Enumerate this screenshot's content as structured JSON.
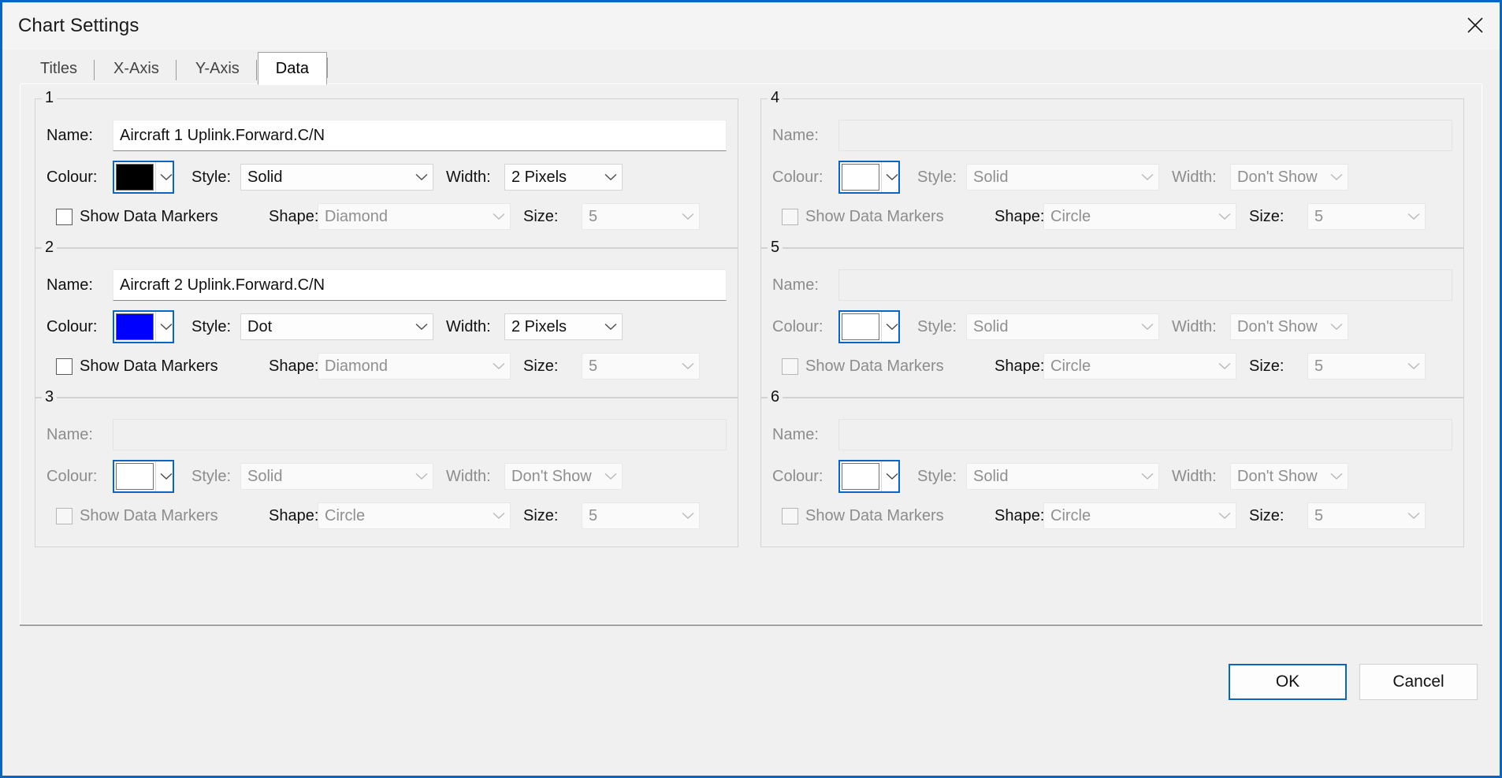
{
  "window": {
    "title": "Chart Settings",
    "close_icon": "close-icon",
    "accent_color": "#0a65c2",
    "background_color": "#f0f0f0"
  },
  "tabs": [
    {
      "label": "Titles",
      "active": false
    },
    {
      "label": "X-Axis",
      "active": false
    },
    {
      "label": "Y-Axis",
      "active": false
    },
    {
      "label": "Data",
      "active": true
    }
  ],
  "labels": {
    "name": "Name:",
    "colour": "Colour:",
    "style": "Style:",
    "width": "Width:",
    "show_data_markers": "Show Data Markers",
    "shape": "Shape:",
    "size": "Size:"
  },
  "series": [
    {
      "number": "1",
      "name": "Aircraft 1 Uplink.Forward.C/N",
      "name_placeholder": "",
      "colour": "#000000",
      "style": "Solid",
      "width": "2 Pixels",
      "show_data_markers": false,
      "shape": "Diamond",
      "size": "5",
      "enabled": true,
      "markers_enabled": false
    },
    {
      "number": "2",
      "name": "Aircraft 2 Uplink.Forward.C/N",
      "name_placeholder": "",
      "colour": "#0000ff",
      "style": "Dot",
      "width": "2 Pixels",
      "show_data_markers": false,
      "shape": "Diamond",
      "size": "5",
      "enabled": true,
      "markers_enabled": false
    },
    {
      "number": "3",
      "name": "",
      "name_placeholder": "",
      "colour": "#ffffff",
      "style": "Solid",
      "width": "Don't Show",
      "show_data_markers": false,
      "shape": "Circle",
      "size": "5",
      "enabled": false,
      "markers_enabled": false
    },
    {
      "number": "4",
      "name": "",
      "name_placeholder": "",
      "colour": "#ffffff",
      "style": "Solid",
      "width": "Don't Show",
      "show_data_markers": false,
      "shape": "Circle",
      "size": "5",
      "enabled": false,
      "markers_enabled": false
    },
    {
      "number": "5",
      "name": "",
      "name_placeholder": "",
      "colour": "#ffffff",
      "style": "Solid",
      "width": "Don't Show",
      "show_data_markers": false,
      "shape": "Circle",
      "size": "5",
      "enabled": false,
      "markers_enabled": false
    },
    {
      "number": "6",
      "name": "",
      "name_placeholder": "",
      "colour": "#ffffff",
      "style": "Solid",
      "width": "Don't Show",
      "show_data_markers": false,
      "shape": "Circle",
      "size": "5",
      "enabled": false,
      "markers_enabled": false
    }
  ],
  "footer": {
    "ok_label": "OK",
    "cancel_label": "Cancel",
    "default_button": "OK"
  }
}
